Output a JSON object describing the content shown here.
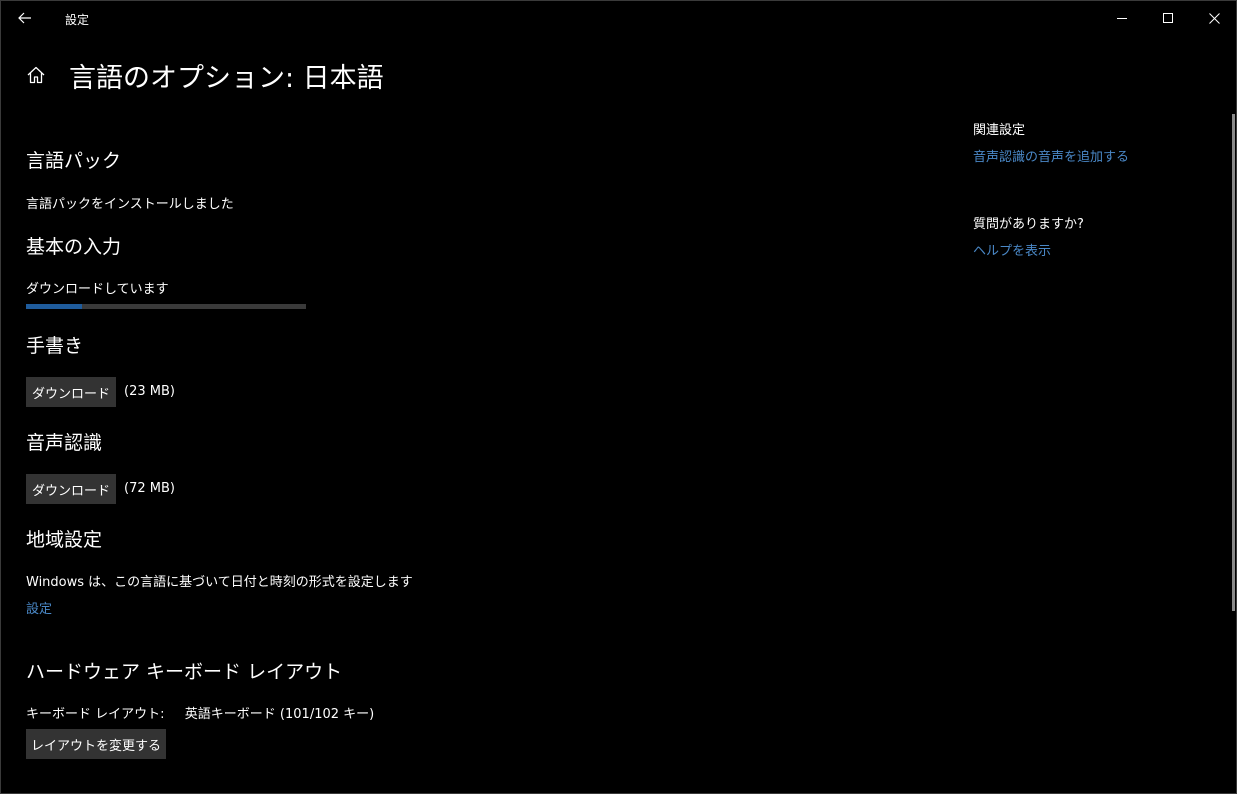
{
  "window": {
    "title": "設定",
    "back_icon": "arrow-left-icon",
    "controls": [
      "minimize-icon",
      "maximize-icon",
      "close-icon"
    ]
  },
  "header": {
    "home_icon": "home-icon",
    "title": "言語のオプション: 日本語"
  },
  "language_pack": {
    "heading": "言語パック",
    "status": "言語パックをインストールしました"
  },
  "basic_input": {
    "heading": "基本の入力",
    "status": "ダウンロードしています",
    "progress_fraction": 0.2
  },
  "handwriting": {
    "heading": "手書き",
    "button_label": "ダウンロード",
    "size": "(23 MB)"
  },
  "speech": {
    "heading": "音声認識",
    "button_label": "ダウンロード",
    "size": "(72 MB)"
  },
  "regional": {
    "heading": "地域設定",
    "description": "Windows は、この言語に基づいて日付と時刻の形式を設定します",
    "link": "設定"
  },
  "hardware_keyboard": {
    "heading": "ハードウェア キーボード レイアウト",
    "layout_label": "キーボード レイアウト:",
    "layout_value": "英語キーボード (101/102 キー)",
    "button_label": "レイアウトを変更する"
  },
  "sidebar": {
    "related_heading": "関連設定",
    "related_link": "音声認識の音声を追加する",
    "question_heading": "質問がありますか?",
    "help_link": "ヘルプを表示"
  },
  "colors": {
    "background": "#000000",
    "accent_link": "#4a88c7",
    "progress_fill": "#1f5c9c",
    "button_bg": "#333333"
  }
}
